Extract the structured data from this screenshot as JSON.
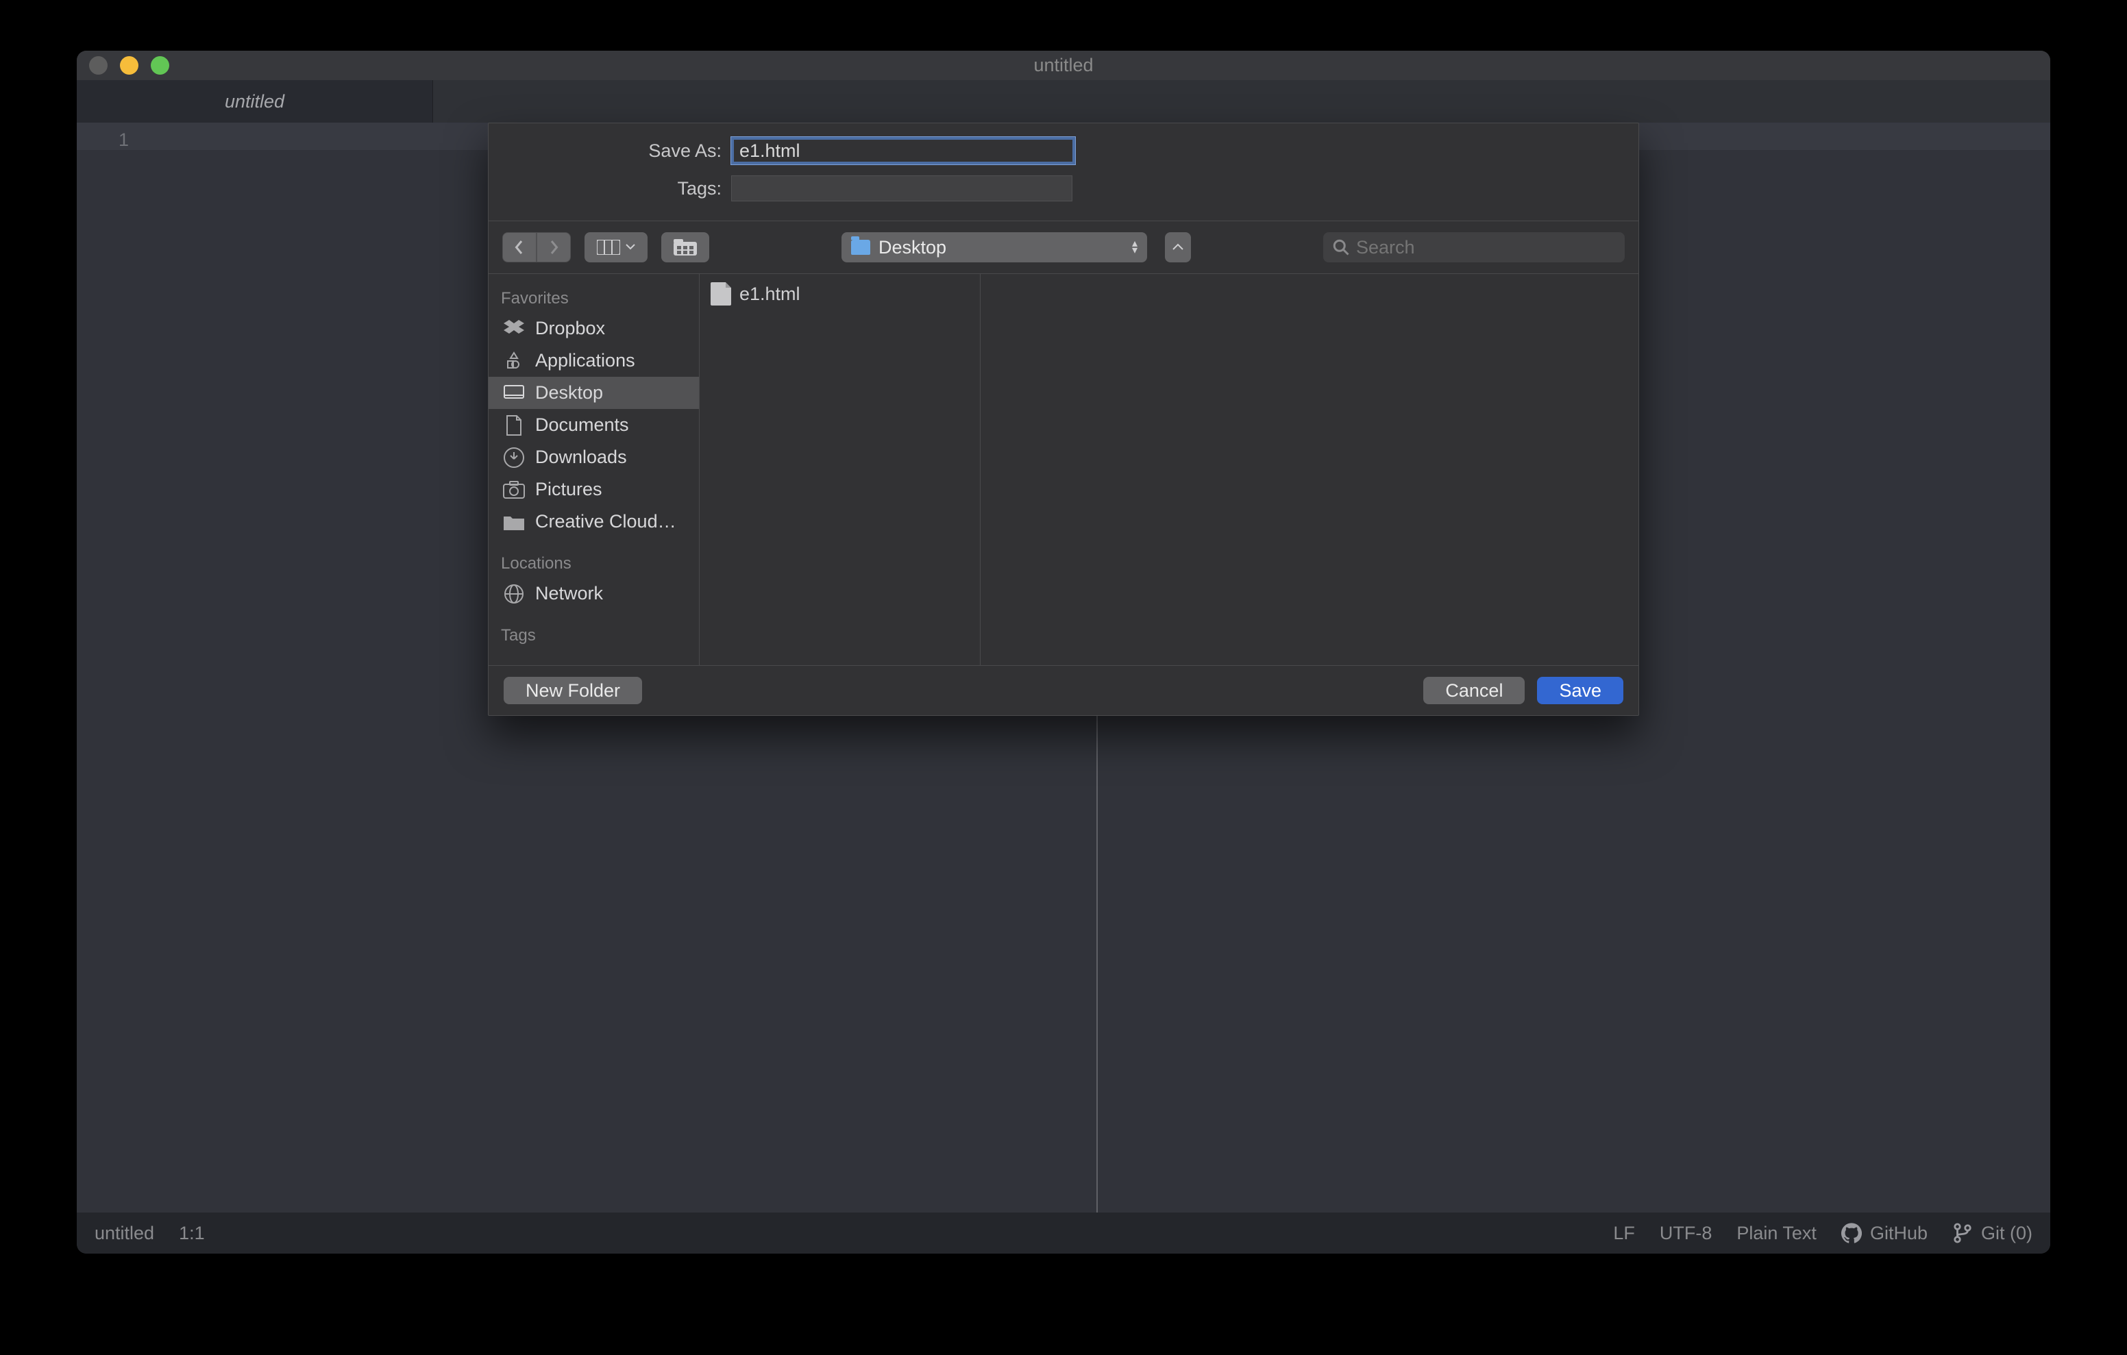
{
  "window": {
    "title": "untitled"
  },
  "tabs": [
    {
      "label": "untitled"
    }
  ],
  "editor": {
    "line_number": "1"
  },
  "statusbar": {
    "file": "untitled",
    "position": "1:1",
    "line_ending": "LF",
    "encoding": "UTF-8",
    "syntax": "Plain Text",
    "github": "GitHub",
    "git": "Git (0)"
  },
  "dialog": {
    "save_as_label": "Save As:",
    "save_as_value": "e1.html",
    "tags_label": "Tags:",
    "location_selected": "Desktop",
    "search_placeholder": "Search",
    "sidebar": {
      "favorites_label": "Favorites",
      "locations_label": "Locations",
      "tags_label": "Tags",
      "favorites": [
        {
          "name": "Dropbox"
        },
        {
          "name": "Applications"
        },
        {
          "name": "Desktop",
          "active": true
        },
        {
          "name": "Documents"
        },
        {
          "name": "Downloads"
        },
        {
          "name": "Pictures"
        },
        {
          "name": "Creative Cloud…"
        }
      ],
      "locations": [
        {
          "name": "Network"
        }
      ]
    },
    "files": [
      {
        "name": "e1.html"
      }
    ],
    "buttons": {
      "new_folder": "New Folder",
      "cancel": "Cancel",
      "save": "Save"
    }
  }
}
